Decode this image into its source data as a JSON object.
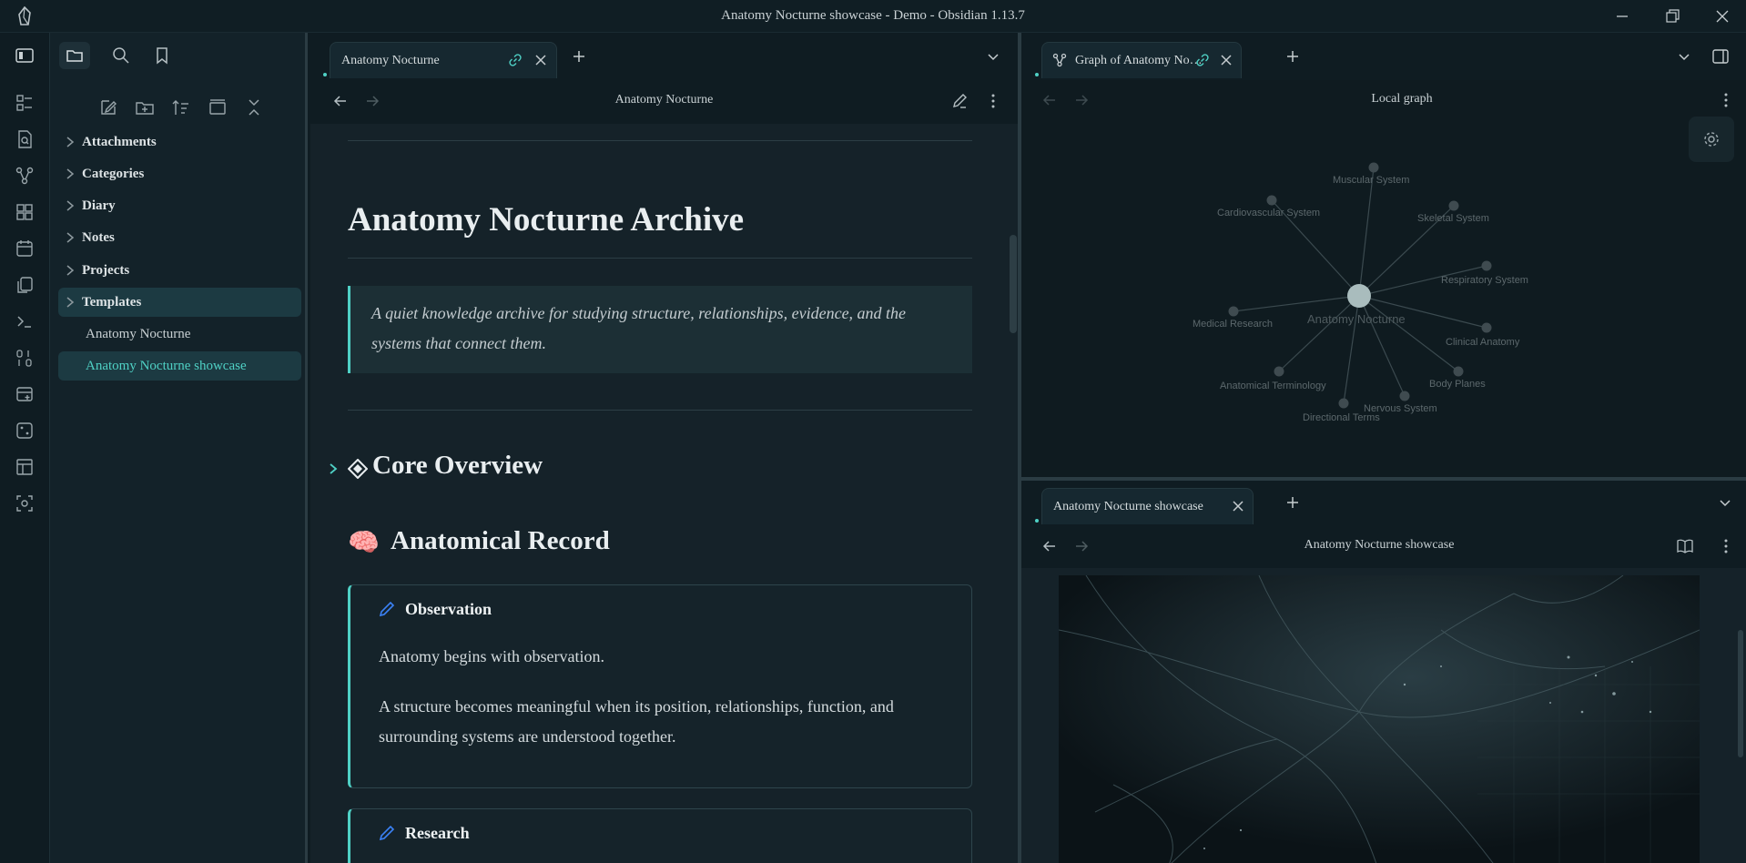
{
  "window": {
    "title": "Anatomy Nocturne showcase - Demo - Obsidian 1.13.7"
  },
  "ribbon": {
    "icons": [
      "sidebar-toggle-icon",
      "dashboard-icon",
      "file-search-icon",
      "graph-icon",
      "grid-icon",
      "calendar-icon",
      "copy-icon",
      "terminal-icon",
      "binary-icon",
      "add-database-icon",
      "dice-icon",
      "layout-icon",
      "scan-icon"
    ]
  },
  "sidebar": {
    "toolbar": [
      "files-icon",
      "search-icon",
      "bookmark-icon"
    ],
    "actions": [
      "new-note-icon",
      "new-folder-icon",
      "sort-icon",
      "collapse-view-icon",
      "collapse-all-icon"
    ],
    "tree": [
      {
        "label": "Attachments",
        "type": "folder"
      },
      {
        "label": "Categories",
        "type": "folder"
      },
      {
        "label": "Diary",
        "type": "folder"
      },
      {
        "label": "Notes",
        "type": "folder"
      },
      {
        "label": "Projects",
        "type": "folder"
      },
      {
        "label": "Templates",
        "type": "folder",
        "state": "hover"
      },
      {
        "label": "Anatomy Nocturne",
        "type": "file"
      },
      {
        "label": "Anatomy Nocturne showcase",
        "type": "file",
        "state": "active"
      }
    ]
  },
  "tabs": {
    "left": {
      "title": "Anatomy Nocturne"
    },
    "right": {
      "title": "Graph of Anatomy No…"
    },
    "bottom": {
      "title": "Anatomy Nocturne showcase"
    }
  },
  "editor": {
    "view_title": "Anatomy Nocturne",
    "h1": "Anatomy Nocturne Archive",
    "quote": "A quiet knowledge archive for studying structure, relationships, evidence, and the systems that connect them.",
    "h2_core": "Core Overview",
    "h2_record_emoji": "🧠",
    "h2_record": "Anatomical Record",
    "callouts": [
      {
        "title": "Observation",
        "paragraphs": [
          "Anatomy begins with observation.",
          "A structure becomes meaningful when its position, relationships, function, and surrounding systems are understood together."
        ]
      },
      {
        "title": "Research",
        "paragraphs": []
      }
    ]
  },
  "graph": {
    "view_title": "Local graph",
    "center": "Anatomy Nocturne",
    "nodes": [
      "Muscular System",
      "Cardiovascular System",
      "Skeletal System",
      "Respiratory System",
      "Medical Research",
      "Clinical Anatomy",
      "Body Planes",
      "Anatomical Terminology",
      "Nervous System",
      "Directional Terms"
    ]
  },
  "bottom": {
    "view_title": "Anatomy Nocturne showcase"
  },
  "colors": {
    "accent": "#4fd1c5",
    "background": "#0f1c22",
    "pencil": "#3b82f6"
  }
}
